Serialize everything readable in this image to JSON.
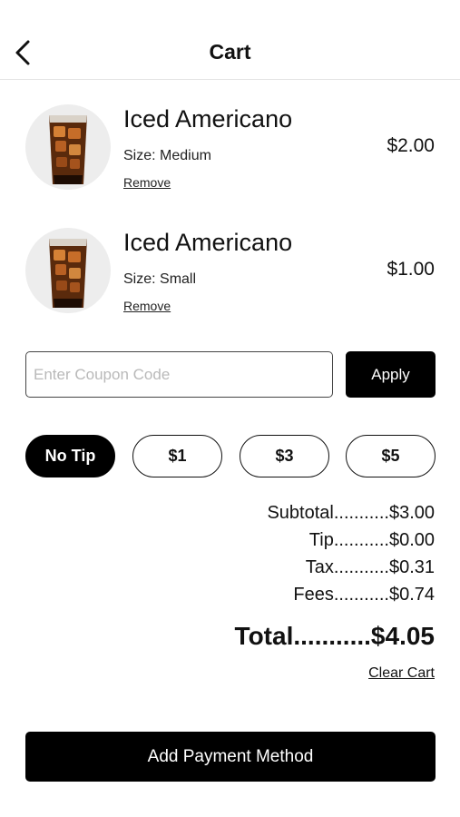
{
  "header": {
    "title": "Cart",
    "back_icon": "chevron-left-icon"
  },
  "items": [
    {
      "name": "Iced Americano",
      "size": "Size: Medium",
      "remove": "Remove",
      "price": "$2.00",
      "image": "iced-americano-image"
    },
    {
      "name": "Iced Americano",
      "size": "Size: Small",
      "remove": "Remove",
      "price": "$1.00",
      "image": "iced-americano-image"
    }
  ],
  "coupon": {
    "placeholder": "Enter Coupon Code",
    "value": "",
    "apply_label": "Apply"
  },
  "tips": [
    {
      "label": "No Tip",
      "selected": true
    },
    {
      "label": "$1",
      "selected": false
    },
    {
      "label": "$3",
      "selected": false
    },
    {
      "label": "$5",
      "selected": false
    }
  ],
  "summary": {
    "subtotal": "Subtotal...........$3.00",
    "tip": "Tip...........$0.00",
    "tax": "Tax...........$0.31",
    "fees": "Fees...........$0.74",
    "total": "Total...........$4.05",
    "clear_cart": "Clear Cart"
  },
  "footer": {
    "payment_label": "Add Payment Method"
  },
  "colors": {
    "primary": "#000000",
    "background": "#ffffff",
    "divider": "#e4e4e4",
    "coffee": "#5a2a0c"
  }
}
